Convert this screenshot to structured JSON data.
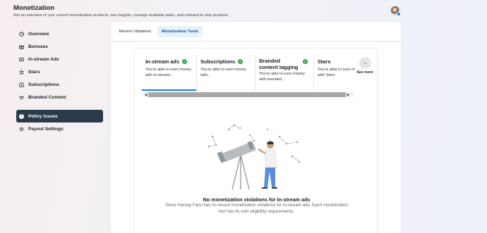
{
  "header": {
    "title": "Monetization",
    "subtitle": "Get an overview of your current monetization products, see insights, manage available tasks, and onboard to new products."
  },
  "sidebar": {
    "items": [
      {
        "label": "Overview",
        "icon": "overview-icon"
      },
      {
        "label": "Bonuses",
        "icon": "bonuses-icon"
      },
      {
        "label": "In-stream Ads",
        "icon": "in-stream-ads-icon"
      },
      {
        "label": "Stars",
        "icon": "star-icon"
      },
      {
        "label": "Subscriptions",
        "icon": "subscriptions-icon"
      },
      {
        "label": "Branded Content",
        "icon": "handshake-icon"
      }
    ],
    "secondary": [
      {
        "label": "Policy Issues",
        "icon": "exclamation-icon",
        "active": true
      },
      {
        "label": "Payout Settings",
        "icon": "gear-icon"
      }
    ]
  },
  "tabs": [
    {
      "label": "Recent Violations",
      "active": false
    },
    {
      "label": "Monetization Tools",
      "active": true
    }
  ],
  "tools": [
    {
      "name": "In-stream ads",
      "desc": "You're able to earn money with in-stream...",
      "eligible": true
    },
    {
      "name": "Subscriptions",
      "desc": "You're able to earn money with...",
      "eligible": true
    },
    {
      "name": "Branded content tagging",
      "desc": "You're able to earn money with branded...",
      "eligible": true
    },
    {
      "name": "Stars",
      "desc": "You're able to earn money with Stars",
      "eligible": false
    }
  ],
  "see_more": "See more",
  "empty_state": {
    "title": "No monetization violations for In-stream ads",
    "description": "Steve Harvey Fans has no recent monetization violations for In-stream ads. Each monetization tool has its own eligibility requirements."
  },
  "colors": {
    "accent": "#1877f2",
    "active_nav": "#2b3a4a",
    "success": "#31a24c",
    "tab_active_bg": "#e7f0fd"
  }
}
